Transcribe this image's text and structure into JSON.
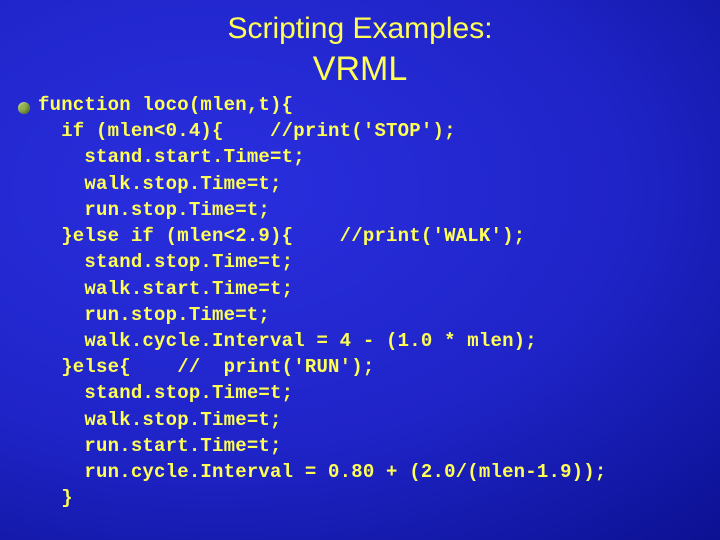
{
  "title": "Scripting Examples:",
  "subtitle": "VRML",
  "code_lines": [
    "function loco(mlen,t){",
    "  if (mlen<0.4){    //print('STOP');",
    "    stand.start.Time=t;",
    "    walk.stop.Time=t;",
    "    run.stop.Time=t;",
    "  }else if (mlen<2.9){    //print('WALK');",
    "    stand.stop.Time=t;",
    "    walk.start.Time=t;",
    "    run.stop.Time=t;",
    "    walk.cycle.Interval = 4 - (1.0 * mlen);",
    "  }else{    //  print('RUN');",
    "    stand.stop.Time=t;",
    "    walk.stop.Time=t;",
    "    run.start.Time=t;",
    "    run.cycle.Interval = 0.80 + (2.0/(mlen-1.9));",
    "  }"
  ]
}
